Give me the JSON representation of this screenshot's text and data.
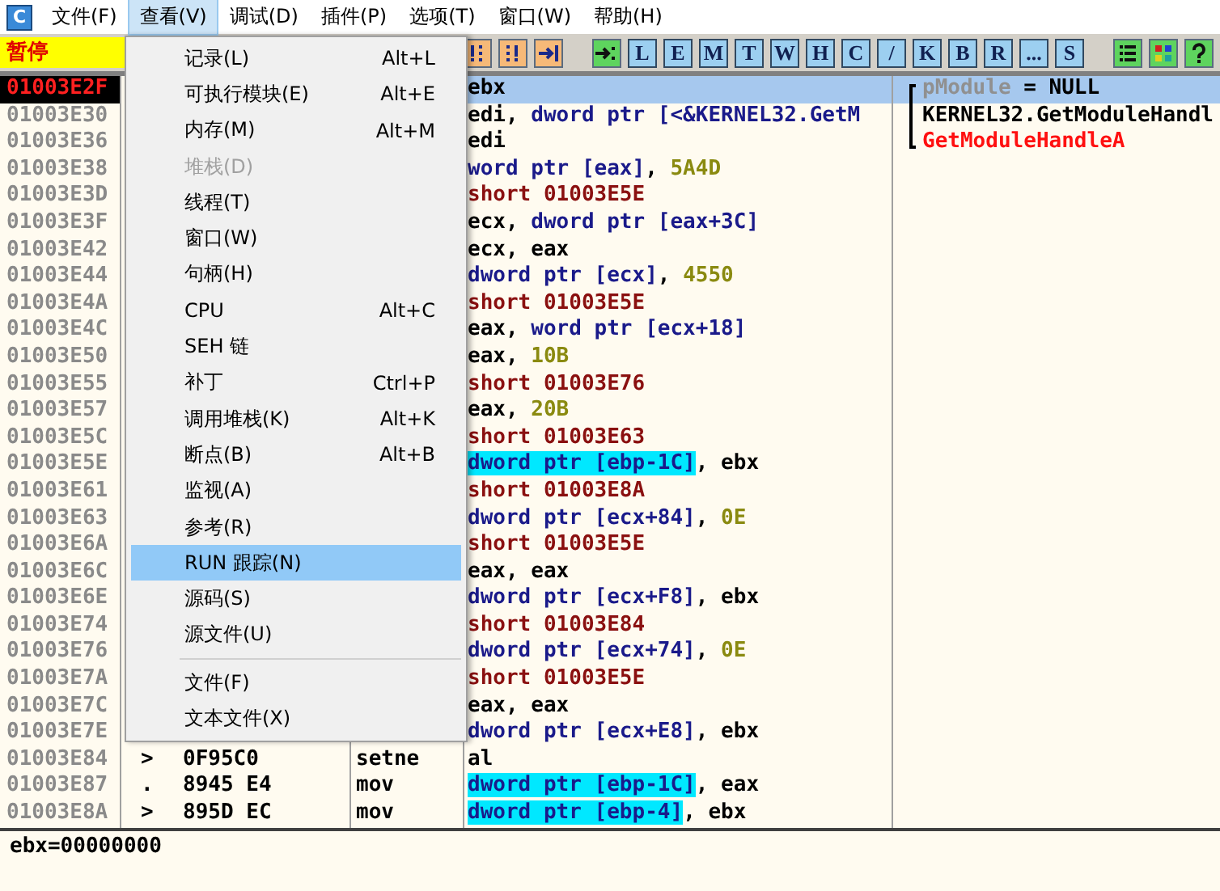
{
  "menubar": {
    "logo": "C",
    "menus": [
      {
        "label": "文件(F)",
        "selected": false
      },
      {
        "label": "查看(V)",
        "selected": true
      },
      {
        "label": "调试(D)",
        "selected": false
      },
      {
        "label": "插件(P)",
        "selected": false
      },
      {
        "label": "选项(T)",
        "selected": false
      },
      {
        "label": "窗口(W)",
        "selected": false
      },
      {
        "label": "帮助(H)",
        "selected": false
      }
    ]
  },
  "toolbar": {
    "status": "暂停",
    "buttons": [
      {
        "kind": "icon"
      },
      {
        "kind": "icon"
      },
      {
        "kind": "icon"
      },
      {
        "kind": "icon"
      },
      {
        "kind": "letter",
        "label": "L"
      },
      {
        "kind": "letter",
        "label": "E"
      },
      {
        "kind": "letter",
        "label": "M"
      },
      {
        "kind": "letter",
        "label": "T"
      },
      {
        "kind": "letter",
        "label": "W"
      },
      {
        "kind": "letter",
        "label": "H"
      },
      {
        "kind": "letter",
        "label": "C"
      },
      {
        "kind": "letter",
        "label": "/"
      },
      {
        "kind": "letter",
        "label": "K"
      },
      {
        "kind": "letter",
        "label": "B"
      },
      {
        "kind": "letter",
        "label": "R"
      },
      {
        "kind": "letter",
        "label": "..."
      },
      {
        "kind": "letter",
        "label": "S"
      },
      {
        "kind": "icon"
      },
      {
        "kind": "icon"
      },
      {
        "kind": "icon"
      }
    ]
  },
  "rows": [
    {
      "address": "01003E2F",
      "current": true,
      "selected": true,
      "operand": [
        {
          "text": "ebx",
          "kind": "plain",
          "highlighted": false
        }
      ],
      "comment": {
        "parts": [
          {
            "text": "pModule",
            "kind": "arg"
          },
          {
            "text": " = NULL",
            "kind": "value"
          }
        ]
      }
    },
    {
      "address": "01003E30",
      "current": false,
      "selected": false,
      "operand": [
        {
          "text": "edi, ",
          "kind": "plain",
          "highlighted": false
        },
        {
          "text": "dword ptr [<&KERNEL32.GetM",
          "kind": "mem",
          "highlighted": false
        }
      ],
      "comment": {
        "parts": [
          {
            "text": "KERNEL32.GetModuleHandl",
            "kind": "value"
          }
        ]
      }
    },
    {
      "address": "01003E36",
      "current": false,
      "selected": false,
      "operand": [
        {
          "text": "edi",
          "kind": "plain",
          "highlighted": false
        }
      ],
      "comment": {
        "parts": [
          {
            "text": "GetModuleHandleA",
            "kind": "api"
          }
        ]
      }
    },
    {
      "address": "01003E38",
      "current": false,
      "selected": false,
      "operand": [
        {
          "text": "word ptr [eax]",
          "kind": "mem",
          "highlighted": false
        },
        {
          "text": ", ",
          "kind": "plain",
          "highlighted": false
        },
        {
          "text": "5A4D",
          "kind": "const",
          "highlighted": false
        }
      ]
    },
    {
      "address": "01003E3D",
      "current": false,
      "selected": false,
      "operand": [
        {
          "text": "short 01003E5E",
          "kind": "jump",
          "highlighted": false
        }
      ]
    },
    {
      "address": "01003E3F",
      "current": false,
      "selected": false,
      "operand": [
        {
          "text": "ecx, ",
          "kind": "plain",
          "highlighted": false
        },
        {
          "text": "dword ptr [eax+3C]",
          "kind": "mem",
          "highlighted": false
        }
      ]
    },
    {
      "address": "01003E42",
      "current": false,
      "selected": false,
      "operand": [
        {
          "text": "ecx, eax",
          "kind": "plain",
          "highlighted": false
        }
      ]
    },
    {
      "address": "01003E44",
      "current": false,
      "selected": false,
      "operand": [
        {
          "text": "dword ptr [ecx]",
          "kind": "mem",
          "highlighted": false
        },
        {
          "text": ", ",
          "kind": "plain",
          "highlighted": false
        },
        {
          "text": "4550",
          "kind": "const",
          "highlighted": false
        }
      ]
    },
    {
      "address": "01003E4A",
      "current": false,
      "selected": false,
      "operand": [
        {
          "text": "short 01003E5E",
          "kind": "jump",
          "highlighted": false
        }
      ]
    },
    {
      "address": "01003E4C",
      "current": false,
      "selected": false,
      "operand": [
        {
          "text": "eax, ",
          "kind": "plain",
          "highlighted": false
        },
        {
          "text": "word ptr [ecx+18]",
          "kind": "mem",
          "highlighted": false
        }
      ]
    },
    {
      "address": "01003E50",
      "current": false,
      "selected": false,
      "operand": [
        {
          "text": "eax, ",
          "kind": "plain",
          "highlighted": false
        },
        {
          "text": "10B",
          "kind": "const",
          "highlighted": false
        }
      ]
    },
    {
      "address": "01003E55",
      "current": false,
      "selected": false,
      "operand": [
        {
          "text": "short 01003E76",
          "kind": "jump",
          "highlighted": false
        }
      ]
    },
    {
      "address": "01003E57",
      "current": false,
      "selected": false,
      "operand": [
        {
          "text": "eax, ",
          "kind": "plain",
          "highlighted": false
        },
        {
          "text": "20B",
          "kind": "const",
          "highlighted": false
        }
      ]
    },
    {
      "address": "01003E5C",
      "current": false,
      "selected": false,
      "operand": [
        {
          "text": "short 01003E63",
          "kind": "jump",
          "highlighted": false
        }
      ]
    },
    {
      "address": "01003E5E",
      "current": false,
      "selected": false,
      "operand": [
        {
          "text": "dword ptr [ebp-1C]",
          "kind": "mem",
          "highlighted": true
        },
        {
          "text": ", ebx",
          "kind": "plain",
          "highlighted": false
        }
      ]
    },
    {
      "address": "01003E61",
      "current": false,
      "selected": false,
      "operand": [
        {
          "text": "short 01003E8A",
          "kind": "jump",
          "highlighted": false
        }
      ]
    },
    {
      "address": "01003E63",
      "current": false,
      "selected": false,
      "operand": [
        {
          "text": "dword ptr [ecx+84]",
          "kind": "mem",
          "highlighted": false
        },
        {
          "text": ", ",
          "kind": "plain",
          "highlighted": false
        },
        {
          "text": "0E",
          "kind": "const",
          "highlighted": false
        }
      ]
    },
    {
      "address": "01003E6A",
      "current": false,
      "selected": false,
      "operand": [
        {
          "text": "short 01003E5E",
          "kind": "jump",
          "highlighted": false
        }
      ]
    },
    {
      "address": "01003E6C",
      "current": false,
      "selected": false,
      "operand": [
        {
          "text": "eax, eax",
          "kind": "plain",
          "highlighted": false
        }
      ]
    },
    {
      "address": "01003E6E",
      "current": false,
      "selected": false,
      "operand": [
        {
          "text": "dword ptr [ecx+F8]",
          "kind": "mem",
          "highlighted": false
        },
        {
          "text": ", ebx",
          "kind": "plain",
          "highlighted": false
        }
      ]
    },
    {
      "address": "01003E74",
      "current": false,
      "selected": false,
      "operand": [
        {
          "text": "short 01003E84",
          "kind": "jump",
          "highlighted": false
        }
      ]
    },
    {
      "address": "01003E76",
      "current": false,
      "selected": false,
      "operand": [
        {
          "text": "dword ptr [ecx+74]",
          "kind": "mem",
          "highlighted": false
        },
        {
          "text": ", ",
          "kind": "plain",
          "highlighted": false
        },
        {
          "text": "0E",
          "kind": "const",
          "highlighted": false
        }
      ]
    },
    {
      "address": "01003E7A",
      "current": false,
      "selected": false,
      "operand": [
        {
          "text": "short 01003E5E",
          "kind": "jump",
          "highlighted": false
        }
      ]
    },
    {
      "address": "01003E7C",
      "current": false,
      "selected": false,
      "operand": [
        {
          "text": "eax, eax",
          "kind": "plain",
          "highlighted": false
        }
      ]
    },
    {
      "address": "01003E7E",
      "current": false,
      "selected": false,
      "operand": [
        {
          "text": "dword ptr [ecx+E8]",
          "kind": "mem",
          "highlighted": false
        },
        {
          "text": ", ebx",
          "kind": "plain",
          "highlighted": false
        }
      ]
    },
    {
      "address": "01003E84",
      "current": false,
      "selected": false,
      "marker": ">",
      "hex": "0F95C0",
      "mnemonic": "setne",
      "operand": [
        {
          "text": "al",
          "kind": "plain",
          "highlighted": false
        }
      ]
    },
    {
      "address": "01003E87",
      "current": false,
      "selected": false,
      "marker": ".",
      "hex": "8945 E4",
      "mnemonic": "mov",
      "operand": [
        {
          "text": "dword ptr [ebp-1C]",
          "kind": "mem",
          "highlighted": true
        },
        {
          "text": ", eax",
          "kind": "plain",
          "highlighted": false
        }
      ]
    },
    {
      "address": "01003E8A",
      "current": false,
      "selected": false,
      "marker": ">",
      "hex": "895D EC",
      "mnemonic": "mov",
      "operand": [
        {
          "text": "dword ptr [ebp-4]",
          "kind": "mem",
          "highlighted": true
        },
        {
          "text": ", ebx",
          "kind": "plain",
          "highlighted": false
        }
      ]
    }
  ],
  "info": "ebx=00000000",
  "view_menu": {
    "items": [
      {
        "label": "记录(L)",
        "shortcut": "Alt+L",
        "disabled": false,
        "selected": false
      },
      {
        "label": "可执行模块(E)",
        "shortcut": "Alt+E",
        "disabled": false,
        "selected": false
      },
      {
        "label": "内存(M)",
        "shortcut": "Alt+M",
        "disabled": false,
        "selected": false
      },
      {
        "label": "堆栈(D)",
        "disabled": true,
        "selected": false
      },
      {
        "label": "线程(T)",
        "disabled": false,
        "selected": false
      },
      {
        "label": "窗口(W)",
        "disabled": false,
        "selected": false
      },
      {
        "label": "句柄(H)",
        "disabled": false,
        "selected": false
      },
      {
        "label": "CPU",
        "shortcut": "Alt+C",
        "disabled": false,
        "selected": false
      },
      {
        "label": "SEH 链",
        "disabled": false,
        "selected": false
      },
      {
        "label": "补丁",
        "shortcut": "Ctrl+P",
        "disabled": false,
        "selected": false
      },
      {
        "label": "调用堆栈(K)",
        "shortcut": "Alt+K",
        "disabled": false,
        "selected": false
      },
      {
        "label": "断点(B)",
        "shortcut": "Alt+B",
        "disabled": false,
        "selected": false
      },
      {
        "label": "监视(A)",
        "disabled": false,
        "selected": false
      },
      {
        "label": "参考(R)",
        "disabled": false,
        "selected": false
      },
      {
        "label": "RUN 跟踪(N)",
        "disabled": false,
        "selected": true
      },
      {
        "label": "源码(S)",
        "disabled": false,
        "selected": false
      },
      {
        "label": "源文件(U)",
        "disabled": false,
        "selected": false,
        "separator_after": true
      },
      {
        "label": "文件(F)",
        "disabled": false,
        "selected": false
      },
      {
        "label": "文本文件(X)",
        "disabled": false,
        "selected": false
      }
    ]
  }
}
